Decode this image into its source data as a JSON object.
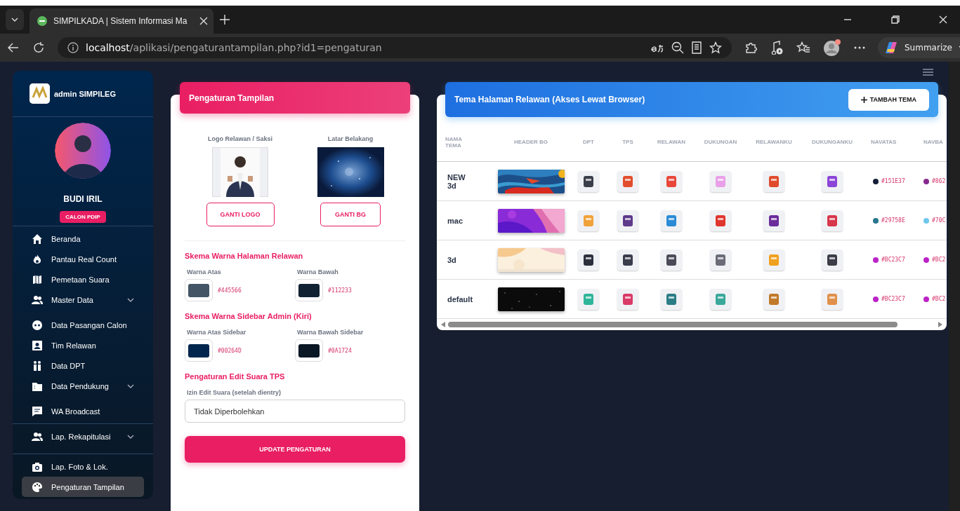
{
  "browser": {
    "tab_title": "SIMPILKADA | Sistem Informasi Ma",
    "url_host": "localhost",
    "url_path": "/aplikasi/pengaturantampilan.php?id1=pengaturan",
    "summarize": "Summarize"
  },
  "sidebar": {
    "brand": "admin SIMPILEG",
    "user_name": "BUDI IRIL",
    "user_badge": "CALON PDIP",
    "groups": [
      [
        {
          "label": "Beranda",
          "submenu": false,
          "selected": false
        },
        {
          "label": "Pantau Real Count",
          "submenu": false,
          "selected": false
        },
        {
          "label": "Pemetaan Suara",
          "submenu": false,
          "selected": false
        },
        {
          "label": "Master Data",
          "submenu": true,
          "selected": false
        },
        {
          "label": "Data Pasangan Calon",
          "submenu": false,
          "selected": false
        },
        {
          "label": "Tim Relawan",
          "submenu": false,
          "selected": false
        },
        {
          "label": "Data DPT",
          "submenu": false,
          "selected": false
        },
        {
          "label": "Data Pendukung",
          "submenu": true,
          "selected": false
        },
        {
          "label": "WA Broadcast",
          "submenu": false,
          "selected": false
        }
      ],
      [
        {
          "label": "Lap. Rekapitulasi",
          "submenu": true,
          "selected": false
        }
      ],
      [
        {
          "label": "Lap. Foto & Lok.",
          "submenu": false,
          "selected": false
        },
        {
          "label": "Pengaturan Tampilan",
          "submenu": false,
          "selected": true
        }
      ]
    ]
  },
  "settings_panel": {
    "title": "Pengaturan Tampilan",
    "logo_label": "Logo Relawan / Saksi",
    "logo_button": "GANTI LOGO",
    "bg_label": "Latar Belakang",
    "bg_button": "GANTI BG",
    "sections": [
      {
        "title": "Skema Warna Halaman Relawan",
        "colors": [
          {
            "label": "Warna Atas",
            "value": "#445566",
            "color": "#445566"
          },
          {
            "label": "Warna Bawah",
            "value": "#112233",
            "color": "#112233"
          }
        ]
      },
      {
        "title": "Skema Warna Sidebar Admin (Kiri)",
        "colors": [
          {
            "label": "Warna Atas Sidebar",
            "value": "#00264D",
            "color": "#00264d"
          },
          {
            "label": "Warna Bawah Sidebar",
            "value": "#0A1724",
            "color": "#0a1724"
          }
        ]
      }
    ],
    "edit_section": {
      "title": "Pengaturan Edit Suara TPS",
      "field_label": "Izin Edit Suara (setelah dientry)",
      "value": "Tidak Diperbolehkan"
    },
    "submit": "UPDATE PENGATURAN"
  },
  "themes": {
    "title": "Tema Halaman Relawan (Akses Lewat Browser)",
    "add_button": "TAMBAH TEMA",
    "columns": [
      "NAMA TEMA",
      "HEADER BG",
      "DPT",
      "TPS",
      "RELAWAN",
      "DUKUNGAN",
      "RELAWANKU",
      "DUKUNGANKU",
      "NAVATAS",
      "NAVBA"
    ],
    "rows": [
      {
        "name": "NEW 3d",
        "navatas": {
          "text": "#151E37",
          "color": "#151e37"
        },
        "navbaw": {
          "text": "#862",
          "color": "#862a8e"
        }
      },
      {
        "name": "mac",
        "navatas": {
          "text": "#29758E",
          "color": "#29758e"
        },
        "navbaw": {
          "text": "#70C",
          "color": "#70c8f0"
        }
      },
      {
        "name": "3d",
        "navatas": {
          "text": "#BC23C7",
          "color": "#bc23c7"
        },
        "navbaw": {
          "text": "#BC2",
          "color": "#bc23c7"
        }
      },
      {
        "name": "default",
        "navatas": {
          "text": "#BC23C7",
          "color": "#bc23c7"
        },
        "navbaw": {
          "text": "#BC2",
          "color": "#bc23c7"
        }
      }
    ]
  }
}
